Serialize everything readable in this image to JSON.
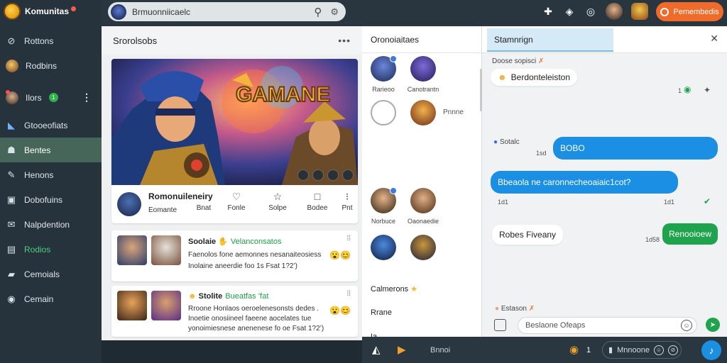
{
  "sidebar": {
    "brand": "Komunitas",
    "items": [
      {
        "label": "Rottons",
        "icon": "compass-icon"
      },
      {
        "label": "Rodbins",
        "icon": "game-avatar-icon"
      },
      {
        "label": "Ilors",
        "icon": "user-avatar-icon",
        "badge": "1"
      },
      {
        "label": "Gtooeofiats",
        "icon": "bookmark-icon"
      },
      {
        "label": "Bentes",
        "icon": "people-icon"
      },
      {
        "label": "Henons",
        "icon": "controller-icon"
      },
      {
        "label": "Dobofuins",
        "icon": "document-icon"
      },
      {
        "label": "Nalpdention",
        "icon": "mail-icon"
      },
      {
        "label": "Rodios",
        "icon": "chart-icon"
      },
      {
        "label": "Cemoials",
        "icon": "folder-icon"
      },
      {
        "label": "Cemain",
        "icon": "settings-icon"
      }
    ]
  },
  "topbar": {
    "search_value": "Brmuonniicaelc",
    "primary_button": "Pemembedis"
  },
  "feed": {
    "title": "Srorolsobs",
    "more": "•••",
    "post": {
      "hero_text": "GAMANE",
      "author": "Romonuileneiry",
      "sub": "Eomante",
      "actions": [
        "Bnat",
        "Fonle",
        "Solpe",
        "Bodee",
        "Pnt"
      ]
    },
    "cards": [
      {
        "title": "Soolaie",
        "tag": "Velanconsatos",
        "line1": "Faenolos fone aemonnes nesanaiteosiess",
        "line2": "Inolaine aneerdie foo 1s Fsat 1?2’)"
      },
      {
        "title": "Stolite",
        "tag": "Bueatfas ’fat",
        "line1": "Rroone Honlaos oeroelenesonsts dedes .",
        "line2": "Inoetie onosiineel faeene aocelates tue",
        "line3": "yonoimiesnese anenenese fo oe Fsat 1?2’)"
      }
    ]
  },
  "friends": {
    "title": "Oronoiaitaes",
    "names": [
      "Rarieoo",
      "Canotrantn",
      "Pnnne",
      "Norbuce",
      "Oaonaedie"
    ],
    "group_label": "Calmerons",
    "label2": "Rrane",
    "label3": "Ia"
  },
  "chat": {
    "tab": "Stamnrign",
    "header_name": "Doose sopisci",
    "msgs": [
      {
        "text": "Berdonteleiston"
      },
      {
        "name": "Sotalc",
        "time": "1sd"
      },
      {
        "text": "BOBO"
      },
      {
        "text": "Bbeaola ne caronnecheoaiaic1cot?"
      },
      {
        "time": "1d1"
      },
      {
        "time": "1d1"
      },
      {
        "text": "Robes Fiveany"
      },
      {
        "time": "1d58"
      },
      {
        "text": "Renooioew"
      }
    ],
    "counter": "1",
    "footer_name": "Estason",
    "input_placeholder": "Beslaone Ofeaps"
  },
  "bottombar": {
    "label": "Bnnoi",
    "count": "1",
    "pill_label": "Mnnoone"
  }
}
